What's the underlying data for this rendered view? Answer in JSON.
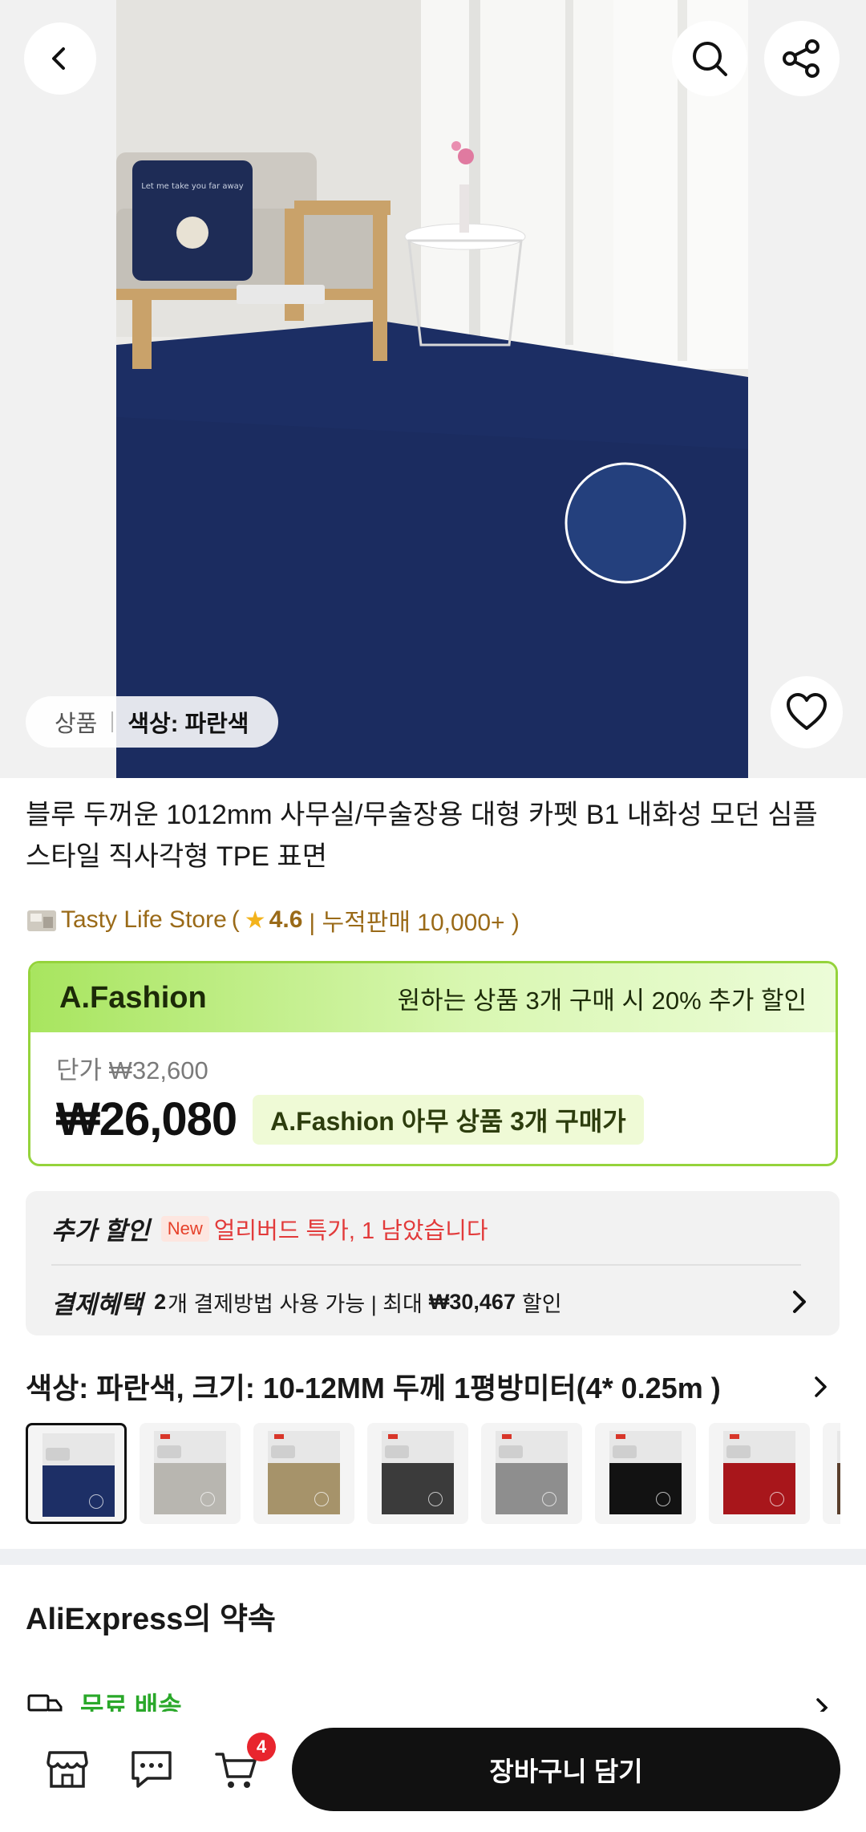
{
  "hero": {
    "chip_left": "상품",
    "chip_right": "색상: 파란색",
    "pillow_text": "Let me take you far away"
  },
  "icons": {
    "back": "chevron-left-icon",
    "search": "search-icon",
    "share": "share-icon",
    "wishlist": "heart-icon"
  },
  "product": {
    "title": "블루 두꺼운 1012mm 사무실/무술장용 대형 카펫 B1 내화성 모던 심플 스타일 직사각형 TPE 표면"
  },
  "store": {
    "name": "Tasty Life Store",
    "open_paren": "(",
    "rating": "4.6",
    "sales": "| 누적판매 10,000+ )"
  },
  "fashion": {
    "brand": "A.Fashion",
    "promo": "원하는 상품 3개 구매 시 20% 추가 할인",
    "unit_price": "단가 ₩32,600",
    "price": "₩26,080",
    "price_tag": "A.Fashion 아무 상품 3개 구매가"
  },
  "benefits": {
    "extra_label": "추가 할인",
    "new_badge": "New",
    "extra_text": "얼리버드 특가, 1 남았습니다",
    "pay_label": "결제혜택",
    "pay_count": "2",
    "pay_text": "개 결제방법 사용 가능 | 최대",
    "pay_amount": "₩30,467",
    "pay_suffix": "할인"
  },
  "variant": {
    "label": "색상: 파란색, 크기: 10-12MM 두께 1평방미터(4* 0.25m )",
    "swatch_colors": [
      "#1d2f66",
      "#b8b6b0",
      "#a6936a",
      "#3b3b3b",
      "#8e8e8e",
      "#121212",
      "#a8161b",
      "#5a3f2c"
    ]
  },
  "promise": {
    "title": "AliExpress의 약속",
    "free_shipping": "무료 배송"
  },
  "bottom": {
    "cart_count": "4",
    "add_to_cart": "장바구니 담기"
  }
}
